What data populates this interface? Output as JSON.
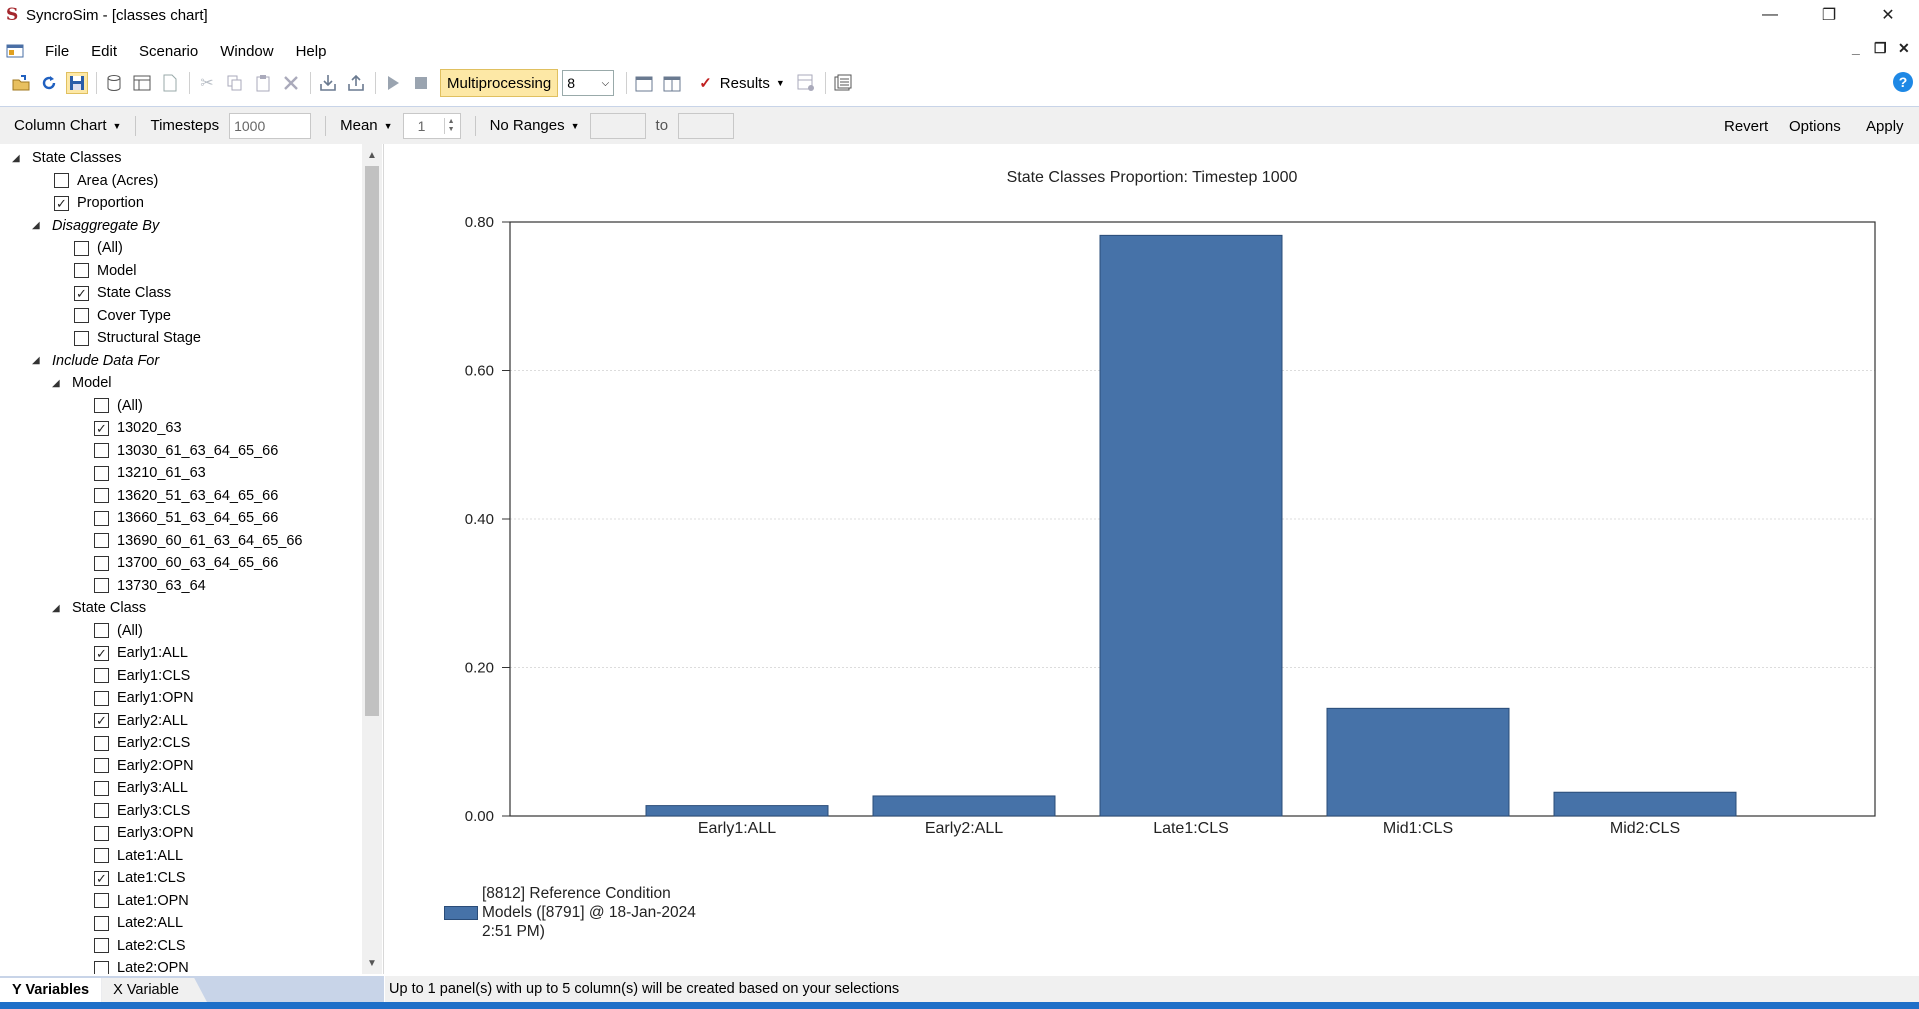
{
  "window": {
    "title": "SyncroSim - [classes chart]",
    "logo_letter": "S",
    "minimize": "—",
    "restore": "❐",
    "close": "✕"
  },
  "menu": {
    "items": [
      "File",
      "Edit",
      "Scenario",
      "Window",
      "Help"
    ]
  },
  "toolbar": {
    "multiprocessing_label": "Multiprocessing",
    "processor_count": "8",
    "results_label": "Results",
    "results_check": "✓",
    "help": "?"
  },
  "chartbar": {
    "chart_type": "Column Chart",
    "timesteps_label": "Timesteps",
    "timesteps_value": "1000",
    "stat": "Mean",
    "stat_value": "1",
    "ranges": "No Ranges",
    "to_label": "to",
    "revert": "Revert",
    "options": "Options",
    "apply": "Apply"
  },
  "tree": [
    {
      "label": "State Classes",
      "level": 0,
      "type": "node",
      "checked": false
    },
    {
      "label": "Area (Acres)",
      "level": 1,
      "type": "check",
      "checked": false
    },
    {
      "label": "Proportion",
      "level": 1,
      "type": "check",
      "checked": true
    },
    {
      "label": "Disaggregate By",
      "level": 1,
      "type": "node",
      "italic": true
    },
    {
      "label": "(All)",
      "level": 2,
      "type": "check",
      "checked": false
    },
    {
      "label": "Model",
      "level": 2,
      "type": "check",
      "checked": false
    },
    {
      "label": "State Class",
      "level": 2,
      "type": "check",
      "checked": true
    },
    {
      "label": "Cover Type",
      "level": 2,
      "type": "check",
      "checked": false
    },
    {
      "label": "Structural Stage",
      "level": 2,
      "type": "check",
      "checked": false
    },
    {
      "label": "Include Data For",
      "level": 1,
      "type": "node",
      "italic": true
    },
    {
      "label": "Model",
      "level": 2,
      "type": "node"
    },
    {
      "label": "(All)",
      "level": 3,
      "type": "check",
      "checked": false
    },
    {
      "label": "13020_63",
      "level": 3,
      "type": "check",
      "checked": true
    },
    {
      "label": "13030_61_63_64_65_66",
      "level": 3,
      "type": "check",
      "checked": false
    },
    {
      "label": "13210_61_63",
      "level": 3,
      "type": "check",
      "checked": false
    },
    {
      "label": "13620_51_63_64_65_66",
      "level": 3,
      "type": "check",
      "checked": false
    },
    {
      "label": "13660_51_63_64_65_66",
      "level": 3,
      "type": "check",
      "checked": false
    },
    {
      "label": "13690_60_61_63_64_65_66",
      "level": 3,
      "type": "check",
      "checked": false
    },
    {
      "label": "13700_60_63_64_65_66",
      "level": 3,
      "type": "check",
      "checked": false
    },
    {
      "label": "13730_63_64",
      "level": 3,
      "type": "check",
      "checked": false
    },
    {
      "label": "State Class",
      "level": 2,
      "type": "node"
    },
    {
      "label": "(All)",
      "level": 3,
      "type": "check",
      "checked": false
    },
    {
      "label": "Early1:ALL",
      "level": 3,
      "type": "check",
      "checked": true
    },
    {
      "label": "Early1:CLS",
      "level": 3,
      "type": "check",
      "checked": false
    },
    {
      "label": "Early1:OPN",
      "level": 3,
      "type": "check",
      "checked": false
    },
    {
      "label": "Early2:ALL",
      "level": 3,
      "type": "check",
      "checked": true
    },
    {
      "label": "Early2:CLS",
      "level": 3,
      "type": "check",
      "checked": false
    },
    {
      "label": "Early2:OPN",
      "level": 3,
      "type": "check",
      "checked": false
    },
    {
      "label": "Early3:ALL",
      "level": 3,
      "type": "check",
      "checked": false
    },
    {
      "label": "Early3:CLS",
      "level": 3,
      "type": "check",
      "checked": false
    },
    {
      "label": "Early3:OPN",
      "level": 3,
      "type": "check",
      "checked": false
    },
    {
      "label": "Late1:ALL",
      "level": 3,
      "type": "check",
      "checked": false
    },
    {
      "label": "Late1:CLS",
      "level": 3,
      "type": "check",
      "checked": true
    },
    {
      "label": "Late1:OPN",
      "level": 3,
      "type": "check",
      "checked": false
    },
    {
      "label": "Late2:ALL",
      "level": 3,
      "type": "check",
      "checked": false
    },
    {
      "label": "Late2:CLS",
      "level": 3,
      "type": "check",
      "checked": false
    },
    {
      "label": "Late2:OPN",
      "level": 3,
      "type": "check",
      "checked": false
    }
  ],
  "bottom_tabs": [
    "Y Variables",
    "X Variable"
  ],
  "status": "Up to 1 panel(s) with up to 5 column(s) will be created based on your selections",
  "colors": {
    "bar": "#4672a8",
    "bar_border": "#2a4c78",
    "accent": "#1e6fc8"
  },
  "chart_data": {
    "type": "bar",
    "title": "State Classes Proportion: Timestep 1000",
    "categories": [
      "Early1:ALL",
      "Early2:ALL",
      "Late1:CLS",
      "Mid1:CLS",
      "Mid2:CLS"
    ],
    "series": [
      {
        "name": "[8812] Reference Condition Models ([8791] @ 18-Jan-2024 2:51 PM)",
        "values": [
          0.014,
          0.027,
          0.782,
          0.145,
          0.032
        ]
      }
    ],
    "yticks": [
      "0.00",
      "0.20",
      "0.40",
      "0.60",
      "0.80"
    ],
    "ylim": [
      0,
      0.8
    ],
    "grid": true,
    "legend_position": "bottom-left"
  }
}
